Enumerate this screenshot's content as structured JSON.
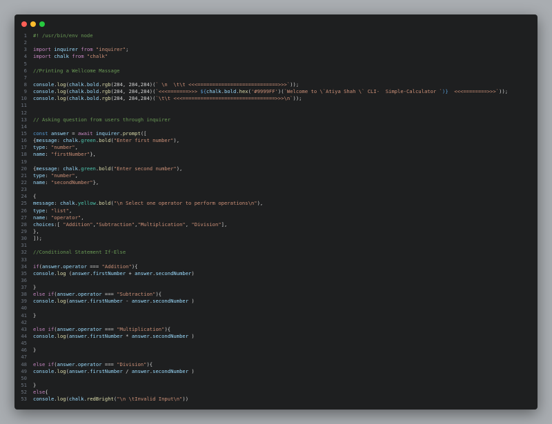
{
  "window": {
    "controls": [
      {
        "name": "close",
        "color": "#ff5f56"
      },
      {
        "name": "minimize",
        "color": "#ffbd2e"
      },
      {
        "name": "maximize",
        "color": "#27c93f"
      }
    ]
  },
  "editor": {
    "lines": [
      [
        {
          "t": "#! /usr/bin/env node",
          "c": "comment"
        }
      ],
      [],
      [
        {
          "t": "import ",
          "c": "kw"
        },
        {
          "t": "inquirer",
          "c": "var"
        },
        {
          "t": " from ",
          "c": "kw"
        },
        {
          "t": "\"inquirer\"",
          "c": "str"
        },
        {
          "t": ";",
          "c": "plain"
        }
      ],
      [
        {
          "t": "import ",
          "c": "kw"
        },
        {
          "t": "chalk",
          "c": "var"
        },
        {
          "t": " from ",
          "c": "kw"
        },
        {
          "t": "\"chalk\"",
          "c": "str"
        }
      ],
      [],
      [
        {
          "t": "//Printing a Wellcome Massage",
          "c": "comment"
        }
      ],
      [],
      [
        {
          "t": "console",
          "c": "var"
        },
        {
          "t": ".",
          "c": "plain"
        },
        {
          "t": "log",
          "c": "fn"
        },
        {
          "t": "(",
          "c": "plain"
        },
        {
          "t": "chalk",
          "c": "var"
        },
        {
          "t": ".",
          "c": "plain"
        },
        {
          "t": "bold",
          "c": "var"
        },
        {
          "t": ".",
          "c": "plain"
        },
        {
          "t": "rgb",
          "c": "fn"
        },
        {
          "t": "(284, 284,284)(",
          "c": "plain"
        },
        {
          "t": "` \\n  \\t\\t <<<===========================>>>`",
          "c": "str"
        },
        {
          "t": "));",
          "c": "plain"
        }
      ],
      [
        {
          "t": "console",
          "c": "var"
        },
        {
          "t": ".",
          "c": "plain"
        },
        {
          "t": "log",
          "c": "fn"
        },
        {
          "t": "(",
          "c": "plain"
        },
        {
          "t": "chalk",
          "c": "var"
        },
        {
          "t": ".",
          "c": "plain"
        },
        {
          "t": "bold",
          "c": "var"
        },
        {
          "t": ".",
          "c": "plain"
        },
        {
          "t": "rgb",
          "c": "fn"
        },
        {
          "t": "(284, 284,284)(",
          "c": "plain"
        },
        {
          "t": "`<<<=======>>> ",
          "c": "str"
        },
        {
          "t": "${",
          "c": "kw2"
        },
        {
          "t": "chalk",
          "c": "var"
        },
        {
          "t": ".",
          "c": "plain"
        },
        {
          "t": "bold",
          "c": "var"
        },
        {
          "t": ".",
          "c": "plain"
        },
        {
          "t": "hex",
          "c": "fn"
        },
        {
          "t": "(",
          "c": "plain"
        },
        {
          "t": "'#9999FF'",
          "c": "str"
        },
        {
          "t": ")(",
          "c": "plain"
        },
        {
          "t": "`Welcome to \\`Atiya Shah \\` CLI-  Simple-Calculator `",
          "c": "str"
        },
        {
          "t": ")}",
          "c": "kw2"
        },
        {
          "t": "  <<<========>>>`",
          "c": "str"
        },
        {
          "t": "));",
          "c": "plain"
        }
      ],
      [
        {
          "t": "console",
          "c": "var"
        },
        {
          "t": ".",
          "c": "plain"
        },
        {
          "t": "log",
          "c": "fn"
        },
        {
          "t": "(",
          "c": "plain"
        },
        {
          "t": "chalk",
          "c": "var"
        },
        {
          "t": ".",
          "c": "plain"
        },
        {
          "t": "bold",
          "c": "var"
        },
        {
          "t": ".",
          "c": "plain"
        },
        {
          "t": "rgb",
          "c": "fn"
        },
        {
          "t": "(284, 284,284)(",
          "c": "plain"
        },
        {
          "t": "`\\t\\t <<<===============================>>>\\n`",
          "c": "str"
        },
        {
          "t": "));",
          "c": "plain"
        }
      ],
      [],
      [],
      [
        {
          "t": "// Asking question from users through inquirer",
          "c": "comment"
        }
      ],
      [],
      [
        {
          "t": "const ",
          "c": "kw2"
        },
        {
          "t": "answer",
          "c": "var"
        },
        {
          "t": " = ",
          "c": "plain"
        },
        {
          "t": "await ",
          "c": "kw"
        },
        {
          "t": "inquirer",
          "c": "var"
        },
        {
          "t": ".",
          "c": "plain"
        },
        {
          "t": "prompt",
          "c": "fn"
        },
        {
          "t": "([",
          "c": "plain"
        }
      ],
      [
        {
          "t": "{",
          "c": "plain"
        },
        {
          "t": "message",
          "c": "var"
        },
        {
          "t": ": ",
          "c": "plain"
        },
        {
          "t": "chalk",
          "c": "var"
        },
        {
          "t": ".",
          "c": "plain"
        },
        {
          "t": "green",
          "c": "obj"
        },
        {
          "t": ".",
          "c": "plain"
        },
        {
          "t": "bold",
          "c": "fn"
        },
        {
          "t": "(",
          "c": "plain"
        },
        {
          "t": "\"Enter first number\"",
          "c": "str"
        },
        {
          "t": "),",
          "c": "plain"
        }
      ],
      [
        {
          "t": "type",
          "c": "var"
        },
        {
          "t": ": ",
          "c": "plain"
        },
        {
          "t": "\"number\"",
          "c": "str"
        },
        {
          "t": ",",
          "c": "plain"
        }
      ],
      [
        {
          "t": "name",
          "c": "var"
        },
        {
          "t": ": ",
          "c": "plain"
        },
        {
          "t": "\"firstNumber\"",
          "c": "str"
        },
        {
          "t": "},",
          "c": "plain"
        }
      ],
      [],
      [
        {
          "t": "{",
          "c": "plain"
        },
        {
          "t": "message",
          "c": "var"
        },
        {
          "t": ": ",
          "c": "plain"
        },
        {
          "t": "chalk",
          "c": "var"
        },
        {
          "t": ".",
          "c": "plain"
        },
        {
          "t": "green",
          "c": "obj"
        },
        {
          "t": ".",
          "c": "plain"
        },
        {
          "t": "bold",
          "c": "fn"
        },
        {
          "t": "(",
          "c": "plain"
        },
        {
          "t": "\"Enter second number\"",
          "c": "str"
        },
        {
          "t": "),",
          "c": "plain"
        }
      ],
      [
        {
          "t": "type",
          "c": "var"
        },
        {
          "t": ": ",
          "c": "plain"
        },
        {
          "t": "\"number\"",
          "c": "str"
        },
        {
          "t": ",",
          "c": "plain"
        }
      ],
      [
        {
          "t": "name",
          "c": "var"
        },
        {
          "t": ": ",
          "c": "plain"
        },
        {
          "t": "\"secondNumber\"",
          "c": "str"
        },
        {
          "t": "},",
          "c": "plain"
        }
      ],
      [],
      [
        {
          "t": "{",
          "c": "plain"
        }
      ],
      [
        {
          "t": "message",
          "c": "var"
        },
        {
          "t": ": ",
          "c": "plain"
        },
        {
          "t": "chalk",
          "c": "var"
        },
        {
          "t": ".",
          "c": "plain"
        },
        {
          "t": "yellow",
          "c": "obj"
        },
        {
          "t": ".",
          "c": "plain"
        },
        {
          "t": "bold",
          "c": "fn"
        },
        {
          "t": "(",
          "c": "plain"
        },
        {
          "t": "\"\\n Select one operator to perform operations\\n\"",
          "c": "str"
        },
        {
          "t": "),",
          "c": "plain"
        }
      ],
      [
        {
          "t": "type",
          "c": "var"
        },
        {
          "t": ": ",
          "c": "plain"
        },
        {
          "t": "\"list\"",
          "c": "str"
        },
        {
          "t": ",",
          "c": "plain"
        }
      ],
      [
        {
          "t": "name",
          "c": "var"
        },
        {
          "t": ": ",
          "c": "plain"
        },
        {
          "t": "\"operator\"",
          "c": "str"
        },
        {
          "t": ",",
          "c": "plain"
        }
      ],
      [
        {
          "t": "choices",
          "c": "var"
        },
        {
          "t": ":[ ",
          "c": "plain"
        },
        {
          "t": "\"Addition\"",
          "c": "str"
        },
        {
          "t": ",",
          "c": "plain"
        },
        {
          "t": "\"Subtraction\"",
          "c": "str"
        },
        {
          "t": ",",
          "c": "plain"
        },
        {
          "t": "\"Multiplication\"",
          "c": "str"
        },
        {
          "t": ", ",
          "c": "plain"
        },
        {
          "t": "\"Division\"",
          "c": "str"
        },
        {
          "t": "],",
          "c": "plain"
        }
      ],
      [
        {
          "t": "},",
          "c": "plain"
        }
      ],
      [
        {
          "t": "]);",
          "c": "plain"
        }
      ],
      [],
      [
        {
          "t": "//Conditional Statement If-Else",
          "c": "comment"
        }
      ],
      [],
      [
        {
          "t": "if",
          "c": "kw"
        },
        {
          "t": "(",
          "c": "plain"
        },
        {
          "t": "answer",
          "c": "var"
        },
        {
          "t": ".",
          "c": "plain"
        },
        {
          "t": "operator",
          "c": "var"
        },
        {
          "t": " === ",
          "c": "plain"
        },
        {
          "t": "\"Addition\"",
          "c": "str"
        },
        {
          "t": "){",
          "c": "plain"
        }
      ],
      [
        {
          "t": "console",
          "c": "var"
        },
        {
          "t": ".",
          "c": "plain"
        },
        {
          "t": "log",
          "c": "fn"
        },
        {
          "t": " (",
          "c": "plain"
        },
        {
          "t": "answer",
          "c": "var"
        },
        {
          "t": ".",
          "c": "plain"
        },
        {
          "t": "firstNumber",
          "c": "var"
        },
        {
          "t": " + ",
          "c": "plain"
        },
        {
          "t": "answer",
          "c": "var"
        },
        {
          "t": ".",
          "c": "plain"
        },
        {
          "t": "secondNumber",
          "c": "var"
        },
        {
          "t": ")",
          "c": "plain"
        }
      ],
      [],
      [
        {
          "t": "}",
          "c": "plain"
        }
      ],
      [
        {
          "t": "else ",
          "c": "kw"
        },
        {
          "t": "if",
          "c": "kw"
        },
        {
          "t": "(",
          "c": "plain"
        },
        {
          "t": "answer",
          "c": "var"
        },
        {
          "t": ".",
          "c": "plain"
        },
        {
          "t": "operator",
          "c": "var"
        },
        {
          "t": " === ",
          "c": "plain"
        },
        {
          "t": "\"Subtraction\"",
          "c": "str"
        },
        {
          "t": "){",
          "c": "plain"
        }
      ],
      [
        {
          "t": "console",
          "c": "var"
        },
        {
          "t": ".",
          "c": "plain"
        },
        {
          "t": "log",
          "c": "fn"
        },
        {
          "t": "(",
          "c": "plain"
        },
        {
          "t": "answer",
          "c": "var"
        },
        {
          "t": ".",
          "c": "plain"
        },
        {
          "t": "firstNumber",
          "c": "var"
        },
        {
          "t": " - ",
          "c": "plain"
        },
        {
          "t": "answer",
          "c": "var"
        },
        {
          "t": ".",
          "c": "plain"
        },
        {
          "t": "secondNumber",
          "c": "var"
        },
        {
          "t": " )",
          "c": "plain"
        }
      ],
      [],
      [
        {
          "t": "}",
          "c": "plain"
        }
      ],
      [],
      [
        {
          "t": "else ",
          "c": "kw"
        },
        {
          "t": "if",
          "c": "kw"
        },
        {
          "t": "(",
          "c": "plain"
        },
        {
          "t": "answer",
          "c": "var"
        },
        {
          "t": ".",
          "c": "plain"
        },
        {
          "t": "operator",
          "c": "var"
        },
        {
          "t": " === ",
          "c": "plain"
        },
        {
          "t": "\"Multiplication\"",
          "c": "str"
        },
        {
          "t": "){",
          "c": "plain"
        }
      ],
      [
        {
          "t": "console",
          "c": "var"
        },
        {
          "t": ".",
          "c": "plain"
        },
        {
          "t": "log",
          "c": "fn"
        },
        {
          "t": "(",
          "c": "plain"
        },
        {
          "t": "answer",
          "c": "var"
        },
        {
          "t": ".",
          "c": "plain"
        },
        {
          "t": "firstNumber",
          "c": "var"
        },
        {
          "t": " * ",
          "c": "plain"
        },
        {
          "t": "answer",
          "c": "var"
        },
        {
          "t": ".",
          "c": "plain"
        },
        {
          "t": "secondNumber",
          "c": "var"
        },
        {
          "t": " )",
          "c": "plain"
        }
      ],
      [],
      [
        {
          "t": "}",
          "c": "plain"
        }
      ],
      [],
      [
        {
          "t": "else ",
          "c": "kw"
        },
        {
          "t": "if",
          "c": "kw"
        },
        {
          "t": "(",
          "c": "plain"
        },
        {
          "t": "answer",
          "c": "var"
        },
        {
          "t": ".",
          "c": "plain"
        },
        {
          "t": "operator",
          "c": "var"
        },
        {
          "t": " === ",
          "c": "plain"
        },
        {
          "t": "\"Division\"",
          "c": "str"
        },
        {
          "t": "){",
          "c": "plain"
        }
      ],
      [
        {
          "t": "console",
          "c": "var"
        },
        {
          "t": ".",
          "c": "plain"
        },
        {
          "t": "log",
          "c": "fn"
        },
        {
          "t": "(",
          "c": "plain"
        },
        {
          "t": "answer",
          "c": "var"
        },
        {
          "t": ".",
          "c": "plain"
        },
        {
          "t": "firstNumber",
          "c": "var"
        },
        {
          "t": " / ",
          "c": "plain"
        },
        {
          "t": "answer",
          "c": "var"
        },
        {
          "t": ".",
          "c": "plain"
        },
        {
          "t": "secondNumber",
          "c": "var"
        },
        {
          "t": " )",
          "c": "plain"
        }
      ],
      [],
      [
        {
          "t": "}",
          "c": "plain"
        }
      ],
      [
        {
          "t": "else",
          "c": "kw"
        },
        {
          "t": "{",
          "c": "plain"
        }
      ],
      [
        {
          "t": "console",
          "c": "var"
        },
        {
          "t": ".",
          "c": "plain"
        },
        {
          "t": "log",
          "c": "fn"
        },
        {
          "t": "(",
          "c": "plain"
        },
        {
          "t": "chalk",
          "c": "var"
        },
        {
          "t": ".",
          "c": "plain"
        },
        {
          "t": "redBright",
          "c": "fn"
        },
        {
          "t": "(",
          "c": "plain"
        },
        {
          "t": "\"\\n \\tInvalid Input\\n\"",
          "c": "str"
        },
        {
          "t": "))",
          "c": "plain"
        }
      ]
    ]
  }
}
